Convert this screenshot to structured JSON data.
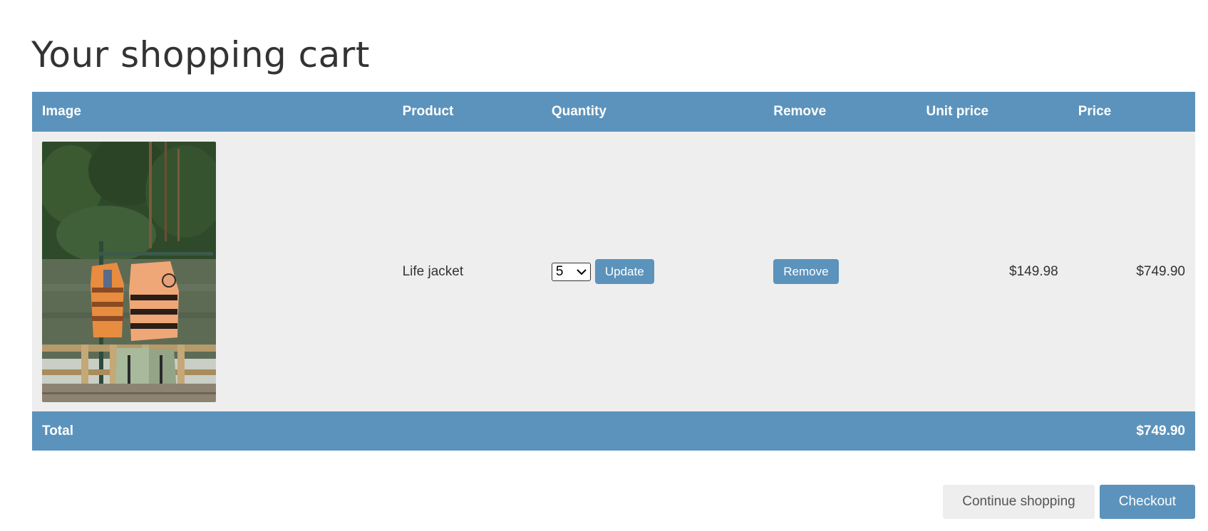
{
  "page": {
    "title": "Your shopping cart"
  },
  "table": {
    "headers": {
      "image": "Image",
      "product": "Product",
      "quantity": "Quantity",
      "remove": "Remove",
      "unit_price": "Unit price",
      "price": "Price"
    },
    "rows": [
      {
        "image_icon": "life-jacket-photo",
        "product": "Life jacket",
        "quantity": "5",
        "update_label": "Update",
        "remove_label": "Remove",
        "unit_price": "$149.98",
        "price": "$749.90"
      }
    ],
    "footer": {
      "label": "Total",
      "total": "$749.90"
    }
  },
  "actions": {
    "continue_label": "Continue shopping",
    "checkout_label": "Checkout"
  },
  "colors": {
    "accent": "#5b93bc",
    "row_background": "#eeeeee",
    "text": "#333333"
  }
}
